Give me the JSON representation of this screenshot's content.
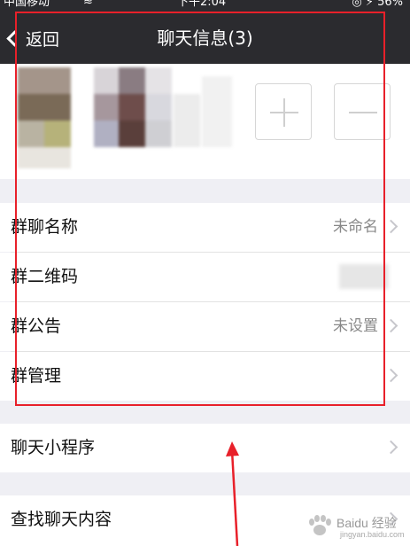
{
  "status_bar": {
    "carrier": "中国移动",
    "wifi_icon": "wifi-icon",
    "time": "下午2:04",
    "right": "◎ ⚡ 56%"
  },
  "nav": {
    "back_label": "返回",
    "title": "聊天信息(3)"
  },
  "members": {
    "add_icon": "plus-icon",
    "remove_icon": "minus-icon"
  },
  "settings": {
    "group_name": {
      "label": "群聊名称",
      "value": "未命名"
    },
    "qr_code": {
      "label": "群二维码"
    },
    "notice": {
      "label": "群公告",
      "value": "未设置"
    },
    "manage": {
      "label": "群管理"
    }
  },
  "mini_program": {
    "label": "聊天小程序"
  },
  "search_chat": {
    "label": "查找聊天内容"
  },
  "annotation": {
    "box_color": "#e8202a",
    "arrow_color": "#e8202a"
  },
  "watermark": {
    "text": "Baidu 经验",
    "sub": "jingyan.baidu.com"
  }
}
